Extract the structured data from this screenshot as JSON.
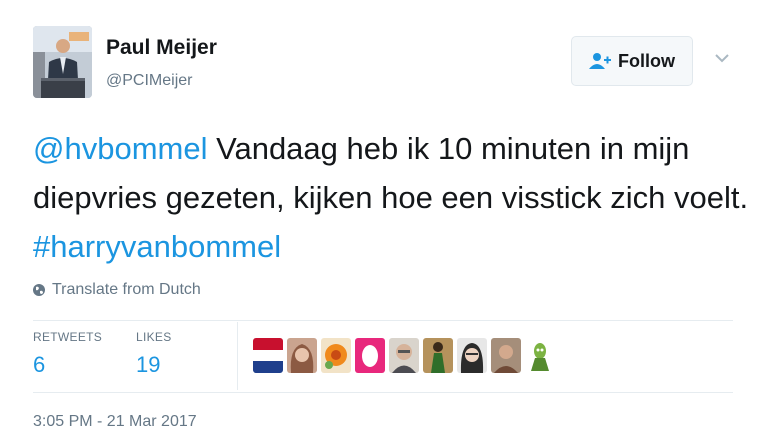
{
  "tweet": {
    "author": {
      "name": "Paul Meijer",
      "handle": "@PCIMeijer"
    },
    "follow_label": "Follow",
    "text_parts": [
      {
        "type": "mention",
        "text": "@hvbommel"
      },
      {
        "type": "text",
        "text": " Vandaag heb ik 10 minuten in mijn diepvries gezeten, kijken hoe een visstick zich voelt. "
      },
      {
        "type": "hashtag",
        "text": "#harryvanbommel"
      }
    ],
    "translate_label": "Translate from Dutch",
    "stats": {
      "retweets_label": "RETWEETS",
      "retweets": "6",
      "likes_label": "LIKES",
      "likes": "19"
    },
    "likers": [
      "netherlands-flag-avatar",
      "woman-avatar",
      "orange-flower-avatar",
      "pink-egg-avatar",
      "older-man-avatar",
      "green-figure-avatar",
      "woman-glasses-avatar",
      "man-avatar",
      "green-cartoon-avatar"
    ],
    "timestamp": "3:05 PM - 21 Mar 2017"
  },
  "colors": {
    "link": "#1b95e0",
    "secondary_text": "#657786",
    "divider": "#e6ecf0"
  }
}
